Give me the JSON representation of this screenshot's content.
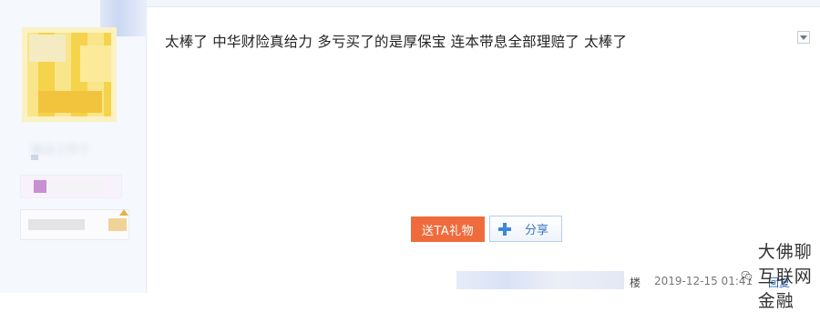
{
  "post": {
    "content": "太棒了 中华财险真给力 多亏买了的是厚保宝 连本带息全部理赔了 太棒了"
  },
  "user": {
    "name_blurred": "跟自工作个"
  },
  "actions": {
    "gift_label": "送TA礼物",
    "share_label": "分享"
  },
  "footer": {
    "floor_suffix": "楼",
    "timestamp": "2019-12-15 01:41",
    "reply_label": "回复"
  },
  "watermark": {
    "text": "大佛聊互联网金融",
    "icon": "wechat-icon"
  },
  "colors": {
    "gift_button": "#f06b3c",
    "share_accent": "#3d87d6",
    "reply_link": "#2d64b3"
  }
}
